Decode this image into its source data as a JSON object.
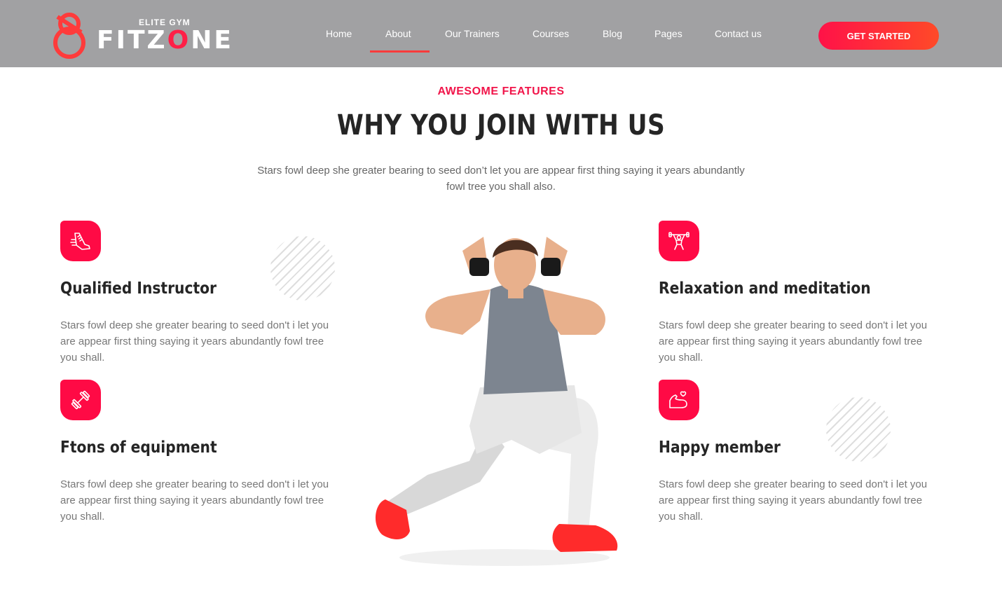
{
  "logo": {
    "subtitle": "ELITE GYM",
    "name_prefix": "FITZ",
    "name_accent": "O",
    "name_suffix": "NE",
    "brand_color": "#ff3b3b"
  },
  "nav": {
    "items": [
      {
        "label": "Home"
      },
      {
        "label": "About"
      },
      {
        "label": "Our Trainers"
      },
      {
        "label": "Courses"
      },
      {
        "label": "Blog"
      },
      {
        "label": "Pages"
      },
      {
        "label": "Contact us"
      }
    ],
    "active": "About",
    "cta_label": "GET STARTED"
  },
  "section": {
    "kicker": "AWESOME FEATURES",
    "title": "WHY YOU JOIN WITH US",
    "lead": "Stars fowl deep she greater bearing to seed don’t let you are appear first thing saying it years abundantly fowl tree you shall also."
  },
  "features": [
    {
      "icon": "running-shoe-icon",
      "title": "Qualified Instructor",
      "text": "Stars fowl deep she greater bearing to seed don't i let you are appear first thing saying it years abundantly fowl tree you shall."
    },
    {
      "icon": "dumbbell-icon",
      "title": "Ftons of equipment",
      "text": "Stars fowl deep she greater bearing to seed don't i let you are appear first thing saying it years abundantly fowl tree you shall."
    },
    {
      "icon": "weightlifter-icon",
      "title": "Relaxation and meditation",
      "text": "Stars fowl deep she greater bearing to seed don't i let you are appear first thing saying it years abundantly fowl tree you shall."
    },
    {
      "icon": "flexed-arm-heart-icon",
      "title": "Happy member",
      "text": "Stars fowl deep she greater bearing to seed don't i let you are appear first thing saying it years abundantly fowl tree you shall."
    }
  ],
  "colors": {
    "accent": "#ff0a45",
    "header_bg": "#a1a1a3",
    "heading": "#252525",
    "body_text": "#777777"
  }
}
